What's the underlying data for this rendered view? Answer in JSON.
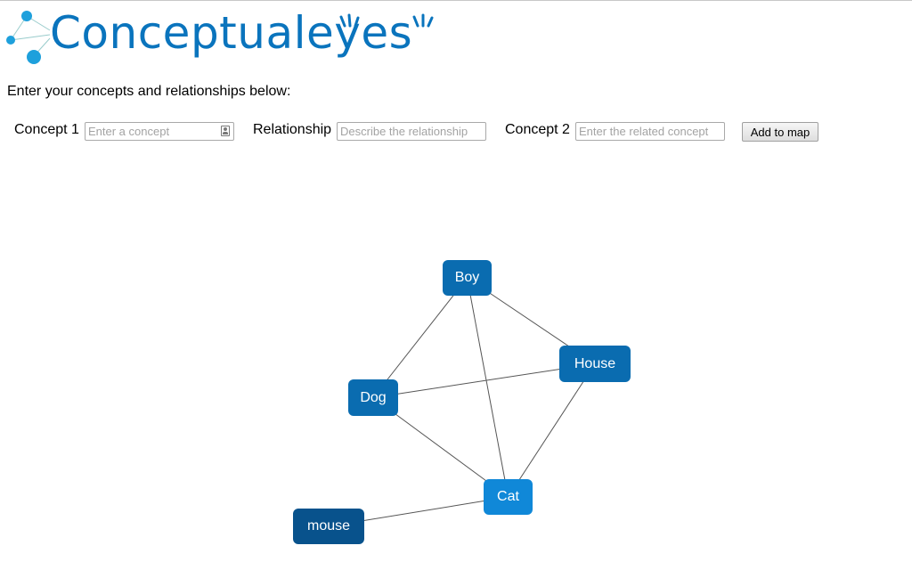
{
  "logo": {
    "text_main": "Conceptual",
    "text_eyes": "eyes",
    "color": "#0a74bd",
    "dot_color": "#1ea0dc"
  },
  "intro_text": "Enter your concepts and relationships below:",
  "form": {
    "concept1_label": "Concept 1",
    "concept1_placeholder": "Enter a concept",
    "concept1_value": "",
    "relationship_label": "Relationship",
    "relationship_placeholder": "Describe the relationship",
    "relationship_value": "",
    "concept2_label": "Concept 2",
    "concept2_placeholder": "Enter the related concept",
    "concept2_value": "",
    "add_button_label": "Add to map"
  },
  "concept_map": {
    "nodes": [
      {
        "id": "boy",
        "label": "Boy",
        "color": "#0a6cb0"
      },
      {
        "id": "house",
        "label": "House",
        "color": "#0a6cb0"
      },
      {
        "id": "dog",
        "label": "Dog",
        "color": "#0a6cb0"
      },
      {
        "id": "cat",
        "label": "Cat",
        "color": "#1088d8"
      },
      {
        "id": "mouse",
        "label": "mouse",
        "color": "#08528c"
      }
    ],
    "edges": [
      {
        "from": "boy",
        "to": "dog"
      },
      {
        "from": "boy",
        "to": "house"
      },
      {
        "from": "boy",
        "to": "cat"
      },
      {
        "from": "dog",
        "to": "house"
      },
      {
        "from": "dog",
        "to": "cat"
      },
      {
        "from": "house",
        "to": "cat"
      },
      {
        "from": "cat",
        "to": "mouse"
      }
    ],
    "edge_color": "#555555"
  }
}
